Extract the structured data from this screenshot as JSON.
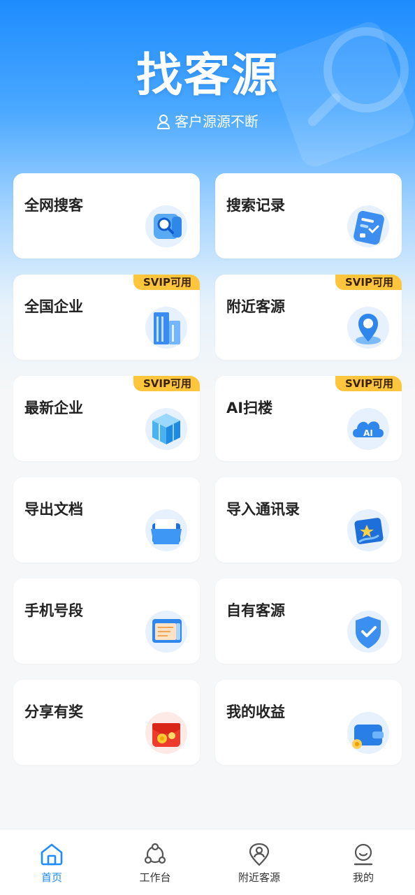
{
  "header": {
    "title": "找客源",
    "subtitle": "客户源源不断",
    "subtitle_icon": "user-icon"
  },
  "cards": [
    {
      "label": "全网搜客",
      "badge": null,
      "icon": "search-magnifier-icon"
    },
    {
      "label": "搜索记录",
      "badge": null,
      "icon": "clipboard-record-icon"
    },
    {
      "label": "全国企业",
      "badge": "SVIP可用",
      "icon": "building-icon"
    },
    {
      "label": "附近客源",
      "badge": "SVIP可用",
      "icon": "location-pin-icon"
    },
    {
      "label": "最新企业",
      "badge": "SVIP可用",
      "icon": "cubes-icon"
    },
    {
      "label": "AI扫楼",
      "badge": "SVIP可用",
      "icon": "ai-cloud-icon"
    },
    {
      "label": "导出文档",
      "badge": null,
      "icon": "folder-icon"
    },
    {
      "label": "导入通讯录",
      "badge": null,
      "icon": "contact-book-star-icon"
    },
    {
      "label": "手机号段",
      "badge": null,
      "icon": "phone-list-icon"
    },
    {
      "label": "自有客源",
      "badge": null,
      "icon": "shield-check-icon"
    },
    {
      "label": "分享有奖",
      "badge": null,
      "icon": "red-packet-icon"
    },
    {
      "label": "我的收益",
      "badge": null,
      "icon": "wallet-icon"
    }
  ],
  "tabbar": {
    "items": [
      {
        "label": "首页",
        "icon": "home-icon",
        "active": true
      },
      {
        "label": "工作台",
        "icon": "workbench-icon",
        "active": false
      },
      {
        "label": "附近客源",
        "icon": "nearby-pin-icon",
        "active": false
      },
      {
        "label": "我的",
        "icon": "profile-icon",
        "active": false
      }
    ]
  },
  "colors": {
    "primary": "#1e8cff",
    "badge_bg": "#ffc53d",
    "text": "#222222",
    "background": "#f5f7f8"
  }
}
